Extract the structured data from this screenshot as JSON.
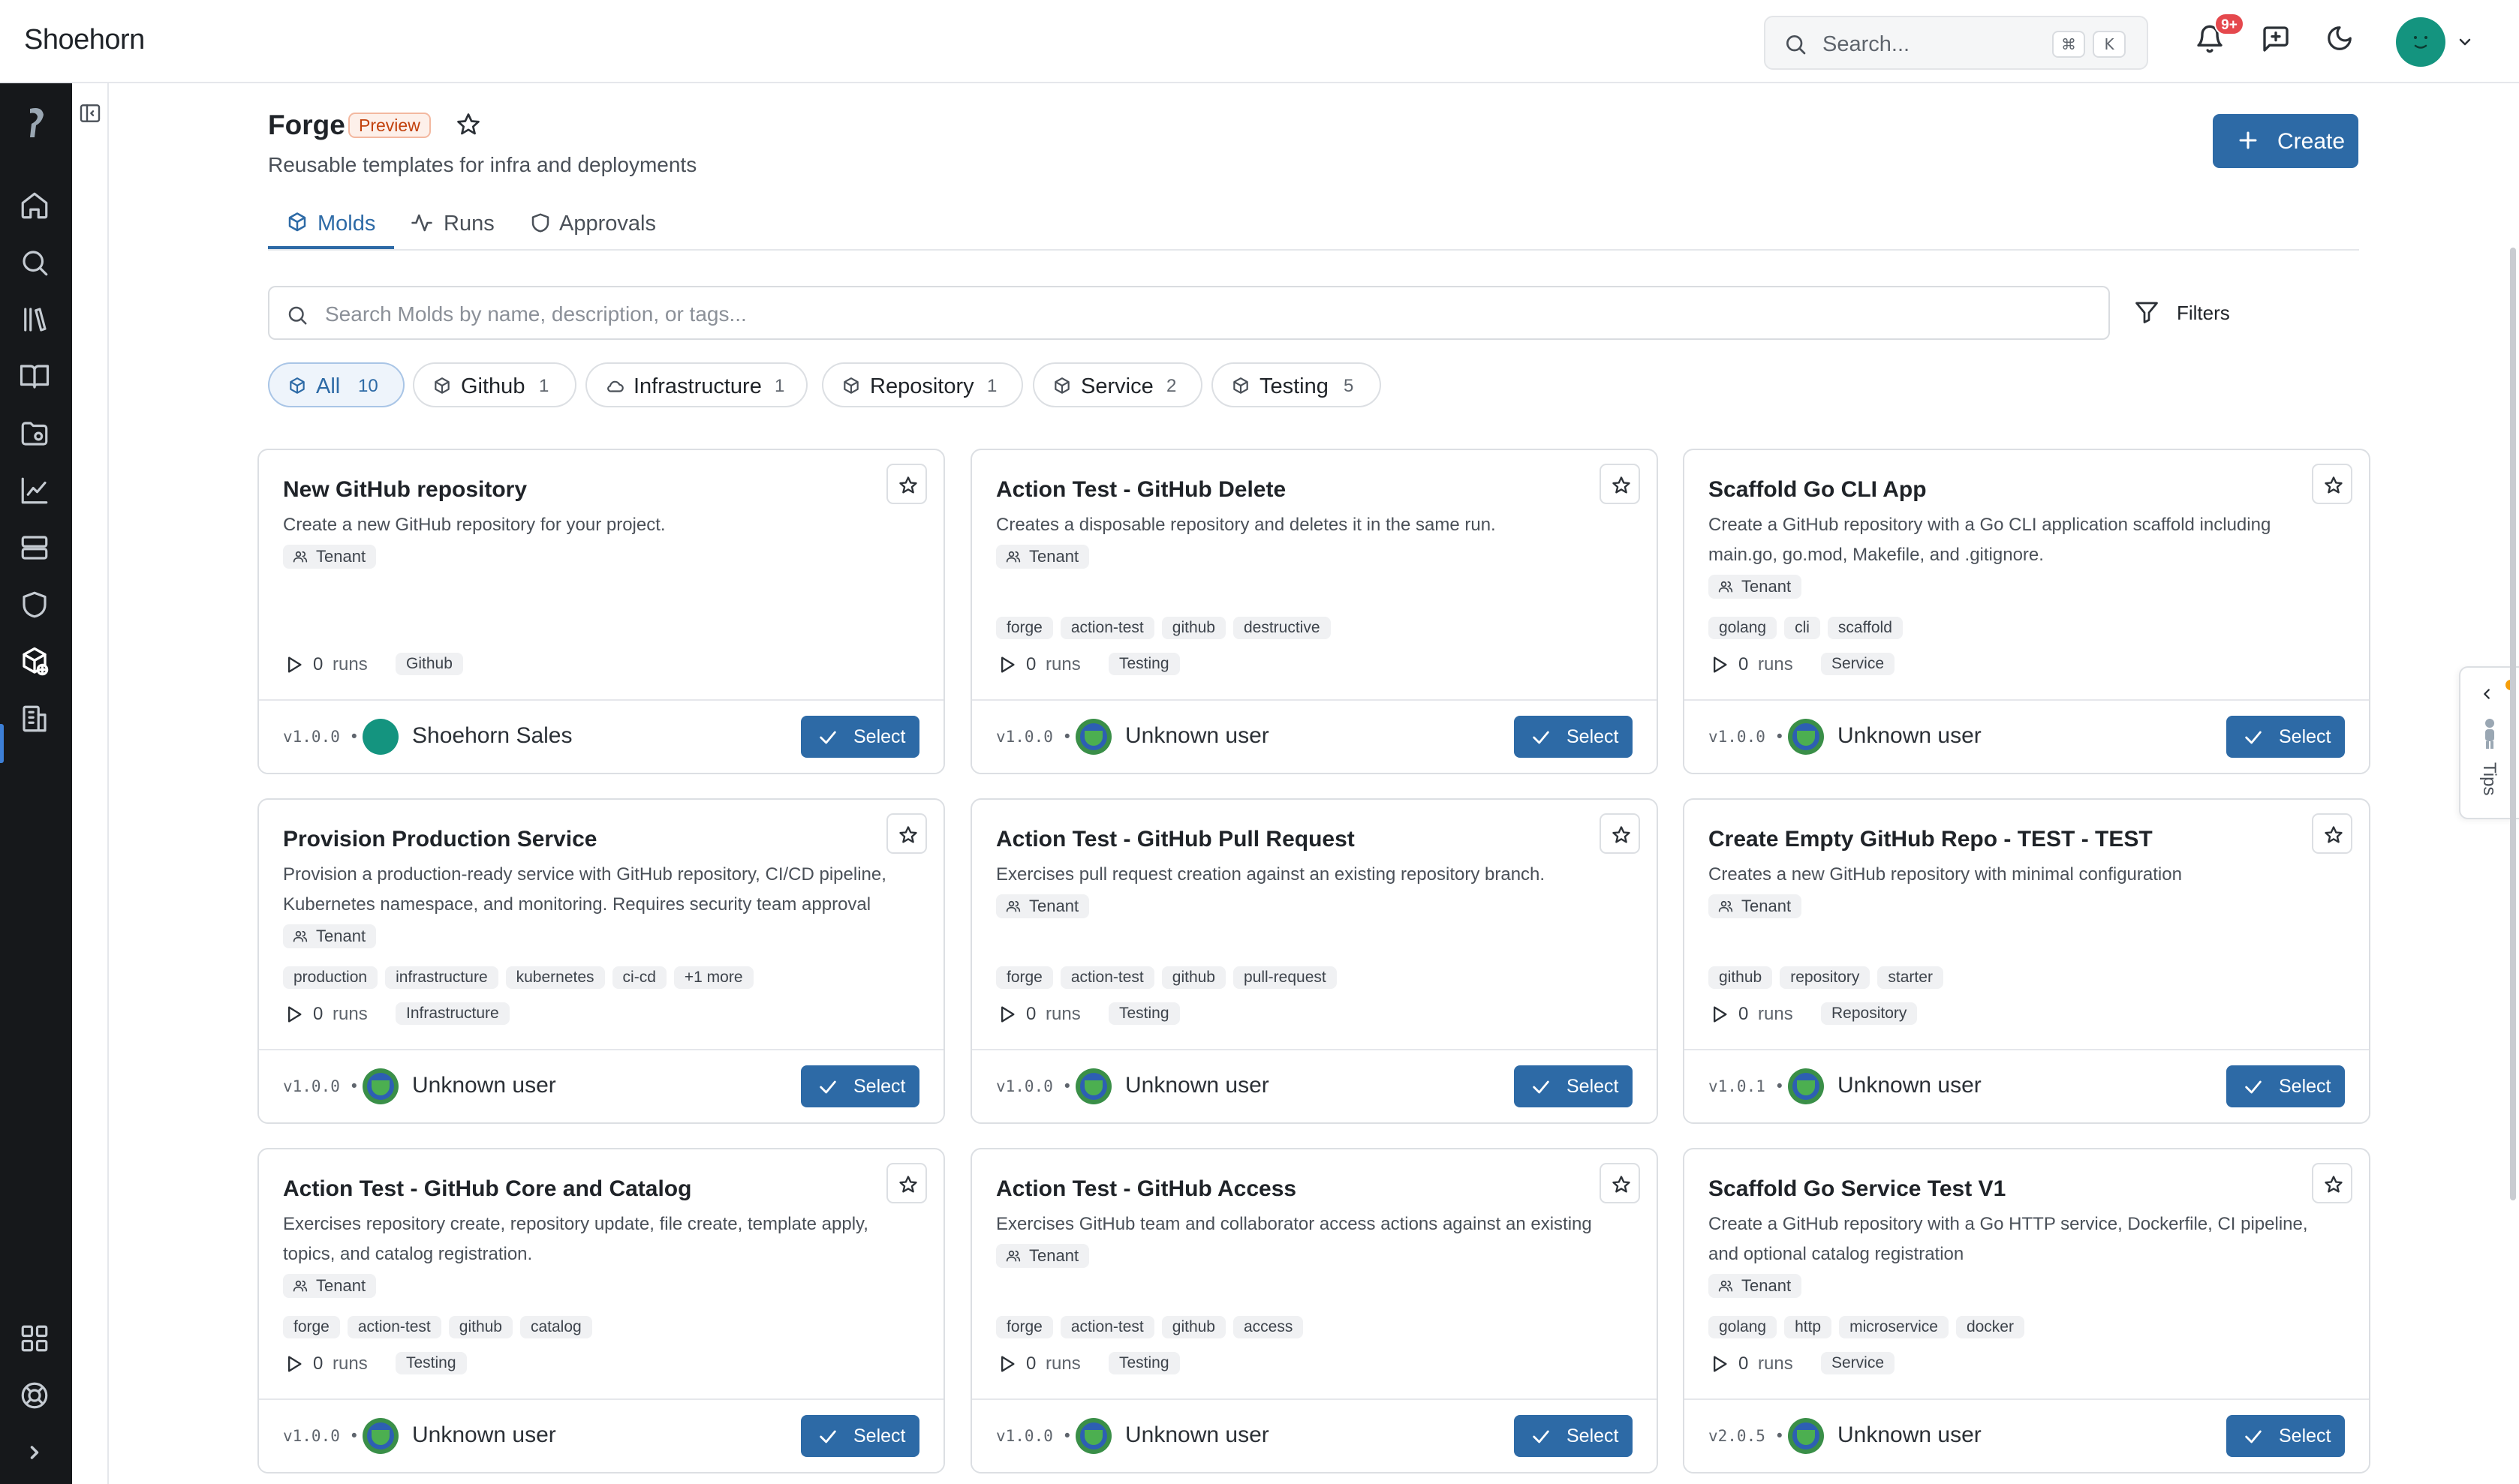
{
  "app": {
    "brand": "Shoehorn"
  },
  "topbar": {
    "search_placeholder": "Search...",
    "shortcut_keys": [
      "⌘",
      "K"
    ],
    "notifications_badge": "9+",
    "icons": [
      "bell-icon",
      "feedback-icon",
      "moon-icon",
      "user-avatar",
      "chevron-down-icon"
    ]
  },
  "sidebar": {
    "items": [
      {
        "name": "home",
        "icon": "home-icon"
      },
      {
        "name": "search",
        "icon": "search-icon"
      },
      {
        "name": "catalog",
        "icon": "library-icon"
      },
      {
        "name": "docs",
        "icon": "book-icon"
      },
      {
        "name": "folders",
        "icon": "folder-icon"
      },
      {
        "name": "metrics",
        "icon": "chart-icon"
      },
      {
        "name": "infrastructure",
        "icon": "server-icon"
      },
      {
        "name": "security",
        "icon": "shield-icon"
      },
      {
        "name": "forge",
        "icon": "forge-icon",
        "active": true
      },
      {
        "name": "organization",
        "icon": "building-icon"
      }
    ],
    "bottom_items": [
      {
        "name": "apps",
        "icon": "grid-icon"
      },
      {
        "name": "help",
        "icon": "lifebuoy-icon"
      },
      {
        "name": "expand",
        "icon": "chevron-right-icon"
      }
    ]
  },
  "page": {
    "title": "Forge",
    "badge": "Preview",
    "subtitle": "Reusable templates for infra and deployments",
    "create_label": "Create"
  },
  "tabs": [
    {
      "label": "Molds",
      "active": true
    },
    {
      "label": "Runs"
    },
    {
      "label": "Approvals"
    }
  ],
  "mold_search": {
    "placeholder": "Search Molds by name, description, or tags..."
  },
  "filters_label": "Filters",
  "categories": [
    {
      "label": "All",
      "count": "10",
      "active": true
    },
    {
      "label": "Github",
      "count": "1"
    },
    {
      "label": "Infrastructure",
      "count": "1"
    },
    {
      "label": "Repository",
      "count": "1"
    },
    {
      "label": "Service",
      "count": "2"
    },
    {
      "label": "Testing",
      "count": "5"
    }
  ],
  "cards": [
    {
      "title": "New GitHub repository",
      "description": "Create a new GitHub repository for your project.",
      "scope": "Tenant",
      "tags": [],
      "runs": "0",
      "runs_label": "runs",
      "category": "Github",
      "version": "v1.0.0 •",
      "author": "Shoehorn Sales",
      "select_label": "Select"
    },
    {
      "title": "Action Test - GitHub Delete",
      "description": "Creates a disposable repository and deletes it in the same run.",
      "scope": "Tenant",
      "tags": [
        "forge",
        "action-test",
        "github",
        "destructive"
      ],
      "runs": "0",
      "runs_label": "runs",
      "category": "Testing",
      "version": "v1.0.0 •",
      "author": "Unknown user",
      "select_label": "Select"
    },
    {
      "title": "Scaffold Go CLI App",
      "description": "Create a GitHub repository with a Go CLI application scaffold including main.go, go.mod, Makefile, and .gitignore.",
      "scope": "Tenant",
      "tags": [
        "golang",
        "cli",
        "scaffold"
      ],
      "runs": "0",
      "runs_label": "runs",
      "category": "Service",
      "version": "v1.0.0 •",
      "author": "Unknown user",
      "select_label": "Select"
    },
    {
      "title": "Provision Production Service",
      "description": "Provision a production-ready service with GitHub repository, CI/CD pipeline, Kubernetes namespace, and monitoring. Requires security team approval before...",
      "scope": "Tenant",
      "tags": [
        "production",
        "infrastructure",
        "kubernetes",
        "ci-cd",
        "+1 more"
      ],
      "runs": "0",
      "runs_label": "runs",
      "category": "Infrastructure",
      "version": "v1.0.0 •",
      "author": "Unknown user",
      "select_label": "Select"
    },
    {
      "title": "Action Test - GitHub Pull Request",
      "description": "Exercises pull request creation against an existing repository branch.",
      "scope": "Tenant",
      "tags": [
        "forge",
        "action-test",
        "github",
        "pull-request"
      ],
      "runs": "0",
      "runs_label": "runs",
      "category": "Testing",
      "version": "v1.0.0 •",
      "author": "Unknown user",
      "select_label": "Select"
    },
    {
      "title": "Create Empty GitHub Repo - TEST - TEST",
      "description": "Creates a new GitHub repository with minimal configuration",
      "scope": "Tenant",
      "tags": [
        "github",
        "repository",
        "starter"
      ],
      "runs": "0",
      "runs_label": "runs",
      "category": "Repository",
      "version": "v1.0.1 •",
      "author": "Unknown user",
      "select_label": "Select"
    },
    {
      "title": "Action Test - GitHub Core and Catalog",
      "description": "Exercises repository create, repository update, file create, template apply, topics, and catalog registration.",
      "scope": "Tenant",
      "tags": [
        "forge",
        "action-test",
        "github",
        "catalog"
      ],
      "runs": "0",
      "runs_label": "runs",
      "category": "Testing",
      "version": "v1.0.0 •",
      "author": "Unknown user",
      "select_label": "Select"
    },
    {
      "title": "Action Test - GitHub Access",
      "description": "Exercises GitHub team and collaborator access actions against an existing repository.",
      "scope": "Tenant",
      "tags": [
        "forge",
        "action-test",
        "github",
        "access"
      ],
      "runs": "0",
      "runs_label": "runs",
      "category": "Testing",
      "version": "v1.0.0 •",
      "author": "Unknown user",
      "select_label": "Select"
    },
    {
      "title": "Scaffold Go Service Test V1",
      "description": "Create a GitHub repository with a Go HTTP service, Dockerfile, CI pipeline, and optional catalog registration",
      "scope": "Tenant",
      "tags": [
        "golang",
        "http",
        "microservice",
        "docker"
      ],
      "runs": "0",
      "runs_label": "runs",
      "category": "Service",
      "version": "v2.0.5 •",
      "author": "Unknown user",
      "select_label": "Select"
    }
  ],
  "tips": {
    "label": "Tips"
  },
  "colors": {
    "accent": "#2d6aa6",
    "rail": "#16181b",
    "preview_badge": "#c2410c",
    "notification": "#e5484d"
  }
}
